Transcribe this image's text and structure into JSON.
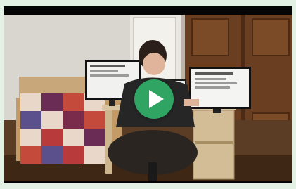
{
  "player": {
    "play_button_label": "",
    "play_icon": "play-icon",
    "accent_color": "#2fa463",
    "frame_color": "#e3f1e4",
    "letterbox_color": "#000000"
  },
  "scene": {
    "left_monitor_icon": "monitor-icon",
    "right_monitor_icon": "monitor-icon"
  }
}
